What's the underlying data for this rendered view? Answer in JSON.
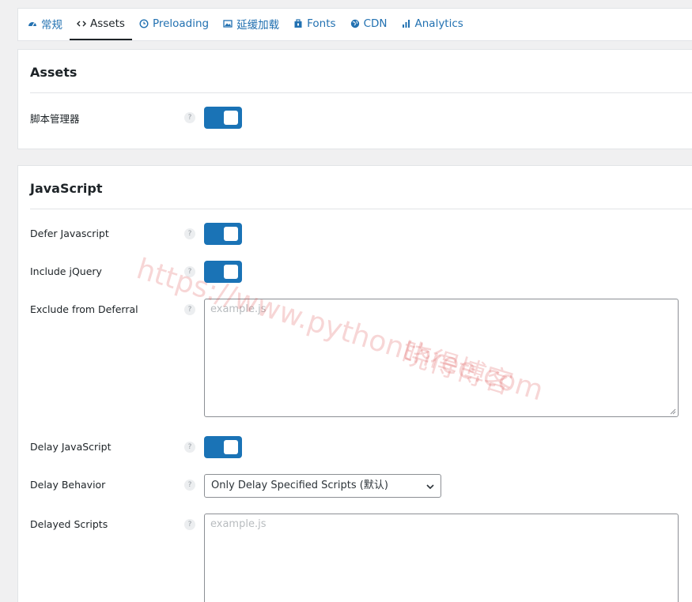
{
  "tabs": [
    {
      "label": "常规",
      "icon": "dashboard-icon"
    },
    {
      "label": "Assets",
      "icon": "code-icon",
      "active": true
    },
    {
      "label": "Preloading",
      "icon": "clock-icon"
    },
    {
      "label": "延缓加载",
      "icon": "image-icon"
    },
    {
      "label": "Fonts",
      "icon": "font-icon"
    },
    {
      "label": "CDN",
      "icon": "globe-icon"
    },
    {
      "label": "Analytics",
      "icon": "chart-icon"
    }
  ],
  "assets": {
    "title": "Assets",
    "script_manager_label": "脚本管理器"
  },
  "javascript": {
    "title": "JavaScript",
    "defer_label": "Defer Javascript",
    "include_jquery_label": "Include jQuery",
    "exclude_label": "Exclude from Deferral",
    "exclude_placeholder": "example.js",
    "delay_label": "Delay JavaScript",
    "delay_behavior_label": "Delay Behavior",
    "delay_behavior_value": "Only Delay Specified Scripts (默认)",
    "delayed_scripts_label": "Delayed Scripts",
    "delayed_placeholder": "example.js"
  },
  "help_glyph": "?",
  "watermark": {
    "line1": "https://www.pythonthree.com",
    "line2": "晓得博客"
  },
  "colors": {
    "accent": "#2271b1",
    "toggle_on": "#1a73b6"
  }
}
